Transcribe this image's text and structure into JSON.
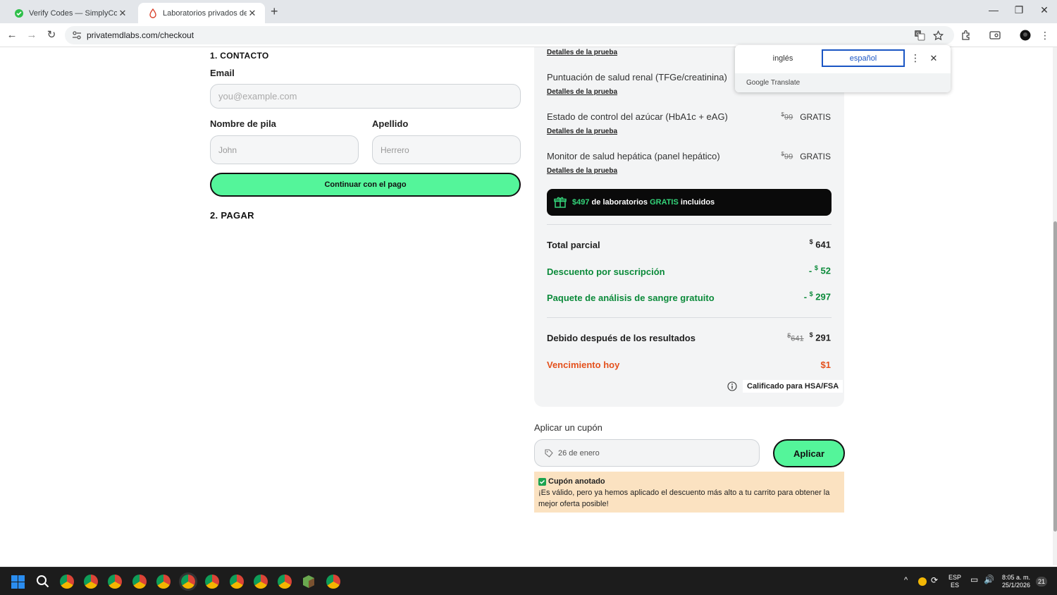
{
  "browser": {
    "tabs": [
      {
        "title": "Verify Codes — SimplyCodes",
        "active": false
      },
      {
        "title": "Laboratorios privados de MD: c",
        "active": true
      }
    ],
    "url": "privatemdlabs.com/checkout"
  },
  "translate": {
    "lang_from": "inglés",
    "lang_to": "español",
    "provider": "Google Translate"
  },
  "contact": {
    "heading": "1. CONTACTO",
    "email_label": "Email",
    "email_placeholder": "you@example.com",
    "first_name_label": "Nombre de pila",
    "first_name_placeholder": "John",
    "last_name_label": "Apellido",
    "last_name_placeholder": "Herrero",
    "continue_label": "Continuar con el pago",
    "pay_heading": "2. PAGAR"
  },
  "summary": {
    "top_detail_link": "Detalles de la prueba",
    "items": [
      {
        "name": "Puntuación de salud renal (TFGe/creatinina)",
        "old_price": "",
        "price": "",
        "detail": "Detalles de la prueba"
      },
      {
        "name": "Estado de control del azúcar (HbA1c + eAG)",
        "old_price": "99",
        "price": "GRATIS",
        "detail": "Detalles de la prueba"
      },
      {
        "name": "Monitor de salud hepática (panel hepático)",
        "old_price": "99",
        "price": "GRATIS",
        "detail": "Detalles de la prueba"
      }
    ],
    "currency": "$",
    "banner_amount": "$497",
    "banner_text_1": "de laboratorios",
    "banner_free": "GRATIS",
    "banner_text_2": "incluidos",
    "subtotal_label": "Total parcial",
    "subtotal_value": "641",
    "discount_label": "Descuento por suscripción",
    "discount_prefix": "-",
    "discount_value": "52",
    "bundle_label": "Paquete de análisis de sangre gratuito",
    "bundle_prefix": "-",
    "bundle_value": "297",
    "due_after_label": "Debido después de los resultados",
    "due_after_old": "641",
    "due_after_value": "291",
    "due_today_label": "Vencimiento hoy",
    "due_today_value": "$1",
    "hsa_label": "Calificado para HSA/FSA"
  },
  "coupon": {
    "label": "Aplicar un cupón",
    "value": "26 de enero",
    "apply_label": "Aplicar",
    "notice_title": "Cupón anotado",
    "notice_text": "¡Es válido, pero ya hemos aplicado el descuento más alto a tu carrito para obtener la mejor oferta posible!"
  },
  "taskbar": {
    "lang_1": "ESP",
    "lang_2": "ES",
    "time": "8:05 a. m.",
    "date": "25/1/2026",
    "notification_count": "21"
  },
  "colors": {
    "accent_green": "#54f59a",
    "discount_green": "#0b8a3a",
    "due_today_orange": "#e4511d",
    "notice_bg": "#fbe2c1"
  }
}
